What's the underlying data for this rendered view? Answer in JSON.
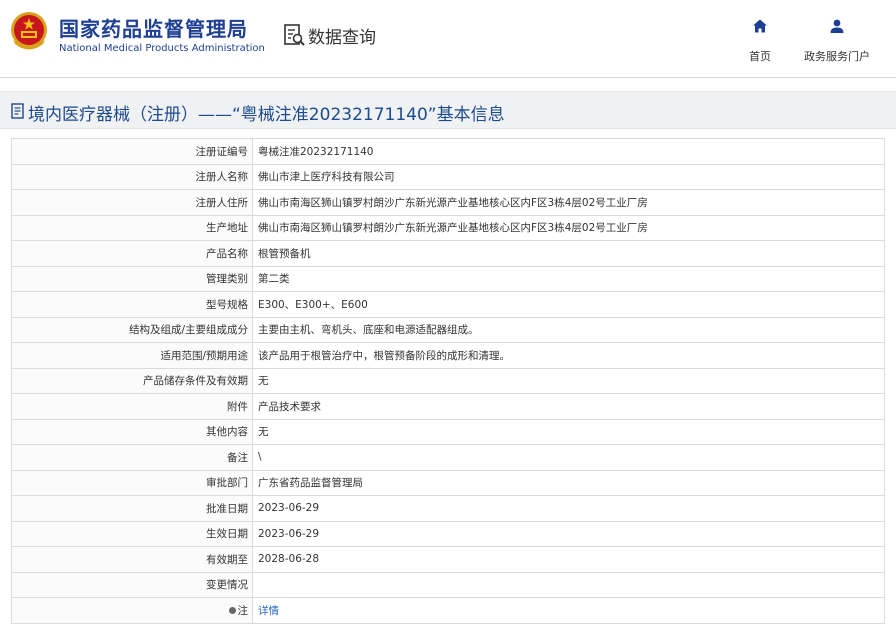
{
  "header": {
    "org_name_cn": "国家药品监督管理局",
    "org_name_en": "National Medical Products Administration",
    "search_title": "数据查询",
    "nav": {
      "home_label": "首页",
      "portal_label": "政务服务门户"
    }
  },
  "page_title": "境内医疗器械（注册）——“粤械注准20232171140”基本信息",
  "details": [
    {
      "label": "注册证编号",
      "value": "粤械注准20232171140"
    },
    {
      "label": "注册人名称",
      "value": "佛山市津上医疗科技有限公司"
    },
    {
      "label": "注册人住所",
      "value": "佛山市南海区狮山镇罗村朗沙广东新光源产业基地核心区内F区3栋4层02号工业厂房"
    },
    {
      "label": "生产地址",
      "value": "佛山市南海区狮山镇罗村朗沙广东新光源产业基地核心区内F区3栋4层02号工业厂房"
    },
    {
      "label": "产品名称",
      "value": "根管预备机"
    },
    {
      "label": "管理类别",
      "value": "第二类"
    },
    {
      "label": "型号规格",
      "value": "E300、E300+、E600"
    },
    {
      "label": "结构及组成/主要组成成分",
      "value": "主要由主机、弯机头、底座和电源适配器组成。"
    },
    {
      "label": "适用范围/预期用途",
      "value": "该产品用于根管治疗中，根管预备阶段的成形和清理。"
    },
    {
      "label": "产品储存条件及有效期",
      "value": "无"
    },
    {
      "label": "附件",
      "value": "产品技术要求"
    },
    {
      "label": "其他内容",
      "value": "无"
    },
    {
      "label": "备注",
      "value": "\\"
    },
    {
      "label": "审批部门",
      "value": "广东省药品监督管理局"
    },
    {
      "label": "批准日期",
      "value": "2023-06-29"
    },
    {
      "label": "生效日期",
      "value": "2023-06-29"
    },
    {
      "label": "有效期至",
      "value": "2028-06-28"
    },
    {
      "label": "变更情况",
      "value": ""
    }
  ],
  "note_row": {
    "label": "注",
    "link_text": "详情"
  },
  "colors": {
    "brand_blue": "#1e3f94",
    "title_blue": "#1d4b8f",
    "link_blue": "#2a6bc2"
  }
}
